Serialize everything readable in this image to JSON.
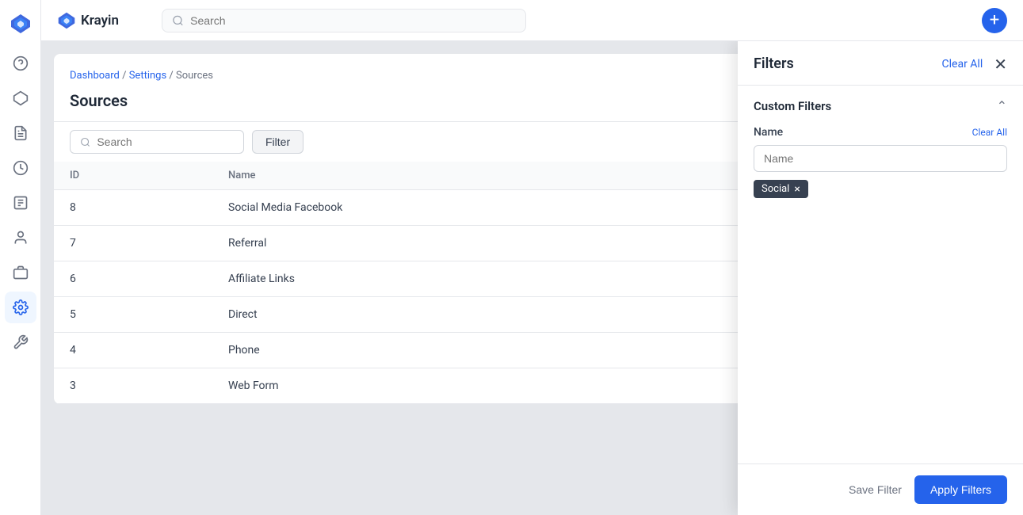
{
  "app": {
    "name": "Krayin",
    "logo_alt": "Krayin logo"
  },
  "header": {
    "search_placeholder": "Search",
    "add_button_label": "+"
  },
  "breadcrumb": {
    "items": [
      "Dashboard",
      "Settings",
      "Sources"
    ],
    "separator": "/"
  },
  "page": {
    "title": "Sources"
  },
  "toolbar": {
    "search_placeholder": "Search",
    "filter_label": "Filter"
  },
  "table": {
    "columns": [
      "ID",
      "Name"
    ],
    "rows": [
      {
        "id": "8",
        "name": "Social Media Facebook"
      },
      {
        "id": "7",
        "name": "Referral"
      },
      {
        "id": "6",
        "name": "Affiliate Links"
      },
      {
        "id": "5",
        "name": "Direct"
      },
      {
        "id": "4",
        "name": "Phone"
      },
      {
        "id": "3",
        "name": "Web Form"
      }
    ]
  },
  "filter_panel": {
    "title": "Filters",
    "clear_all_label": "Clear All",
    "custom_filters_title": "Custom Filters",
    "name_field": {
      "label": "Name",
      "clear_label": "Clear All",
      "placeholder": "Name"
    },
    "active_tag": {
      "label": "Social",
      "close_icon": "×"
    },
    "footer": {
      "save_label": "Save Filter",
      "apply_label": "Apply Filters"
    }
  },
  "sidebar": {
    "items": [
      {
        "icon": "🎧",
        "name": "support-icon",
        "active": false
      },
      {
        "icon": "⬡",
        "name": "pipeline-icon",
        "active": false
      },
      {
        "icon": "📋",
        "name": "tasks-icon",
        "active": false
      },
      {
        "icon": "🕐",
        "name": "clock-icon",
        "active": false
      },
      {
        "icon": "📄",
        "name": "docs-icon",
        "active": false
      },
      {
        "icon": "👤",
        "name": "contacts-icon",
        "active": false
      },
      {
        "icon": "📦",
        "name": "products-icon",
        "active": false
      },
      {
        "icon": "⚙",
        "name": "settings-icon",
        "active": true
      },
      {
        "icon": "🔧",
        "name": "tools-icon",
        "active": false
      }
    ]
  }
}
